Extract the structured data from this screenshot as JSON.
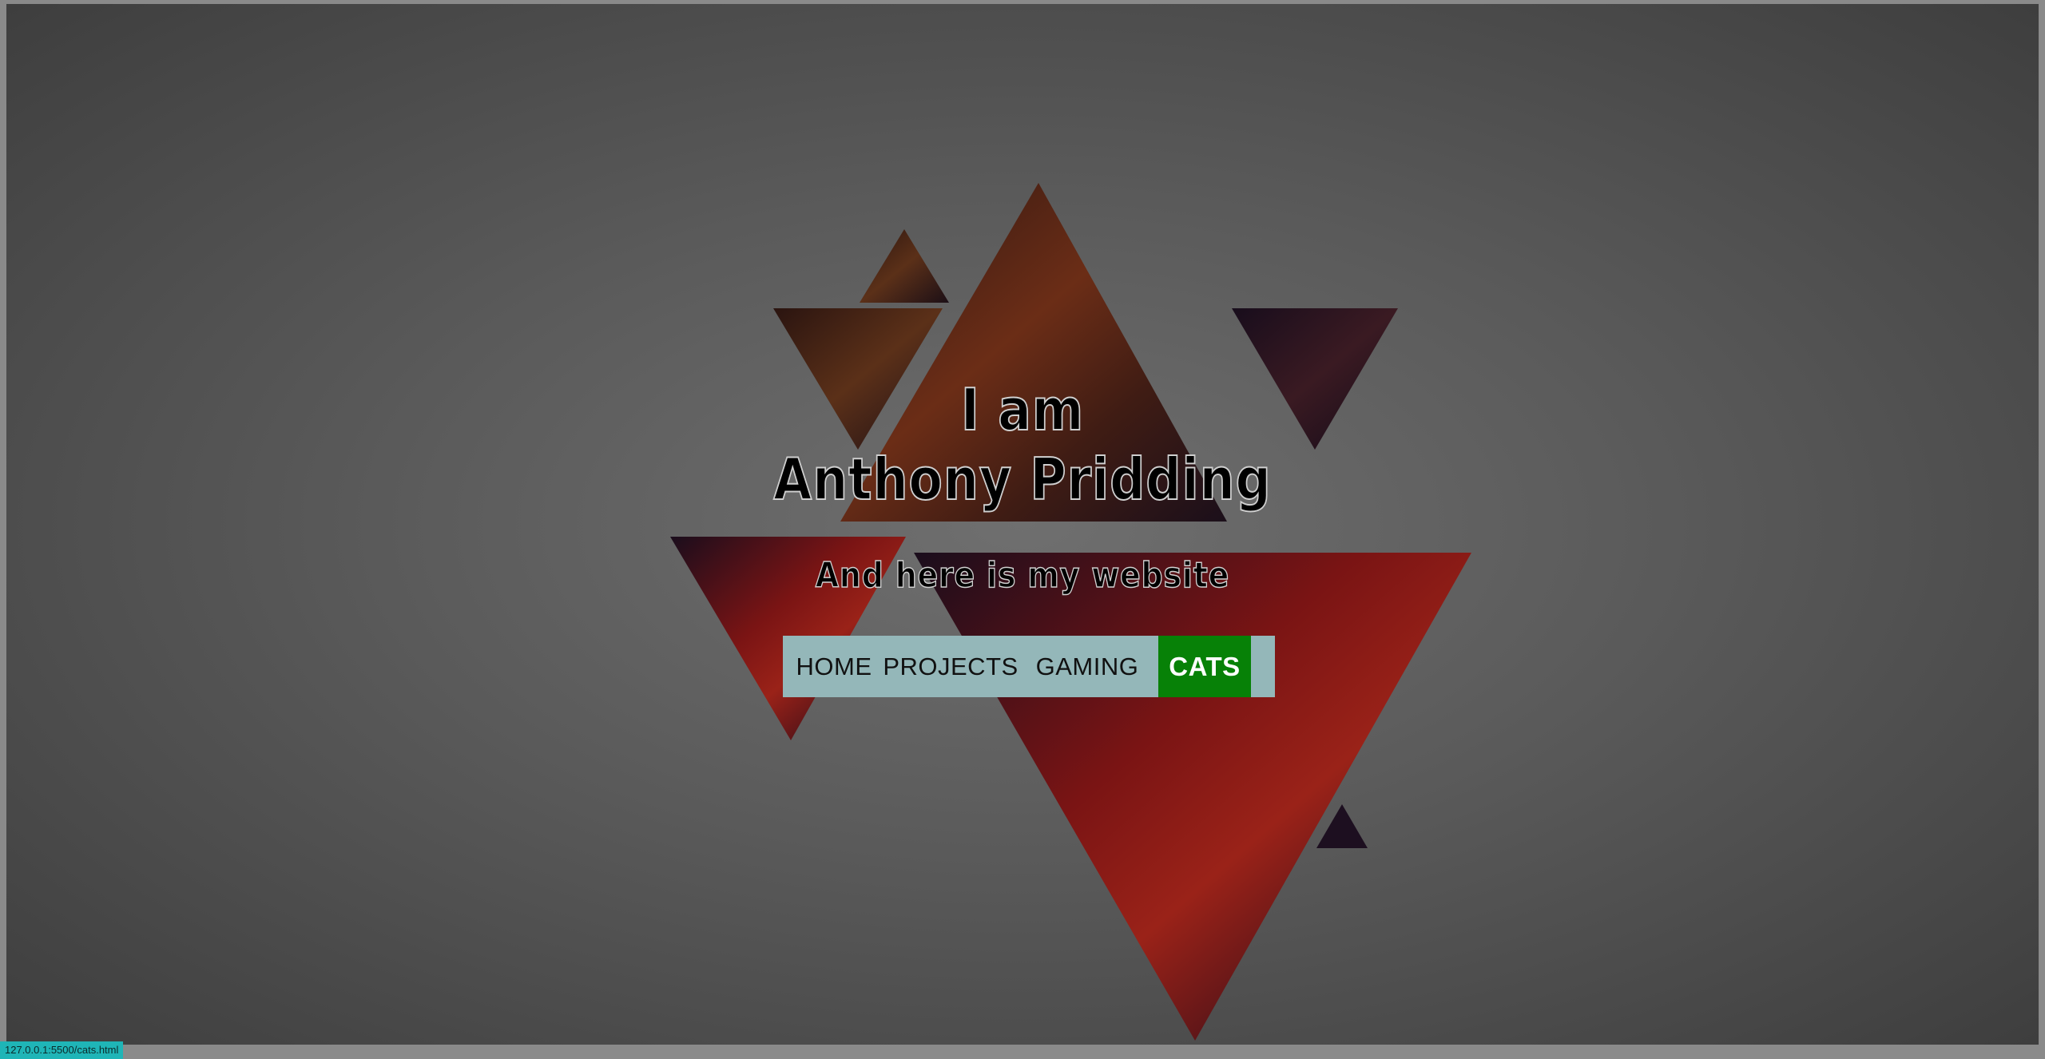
{
  "header": {
    "line1": "I am",
    "line2": "Anthony Pridding",
    "subtitle": "And here is my website"
  },
  "nav": {
    "items": [
      {
        "label": "HOME",
        "active": false
      },
      {
        "label": "PROJECTS",
        "active": false
      },
      {
        "label": "GAMING",
        "active": false
      },
      {
        "label": "CATS",
        "active": true
      }
    ]
  },
  "status_bar": {
    "url": "127.0.0.1:5500/cats.html"
  },
  "colors": {
    "nav_background": "#94b7b9",
    "active_nav": "#078107",
    "page_background": "#5a5a5a"
  }
}
